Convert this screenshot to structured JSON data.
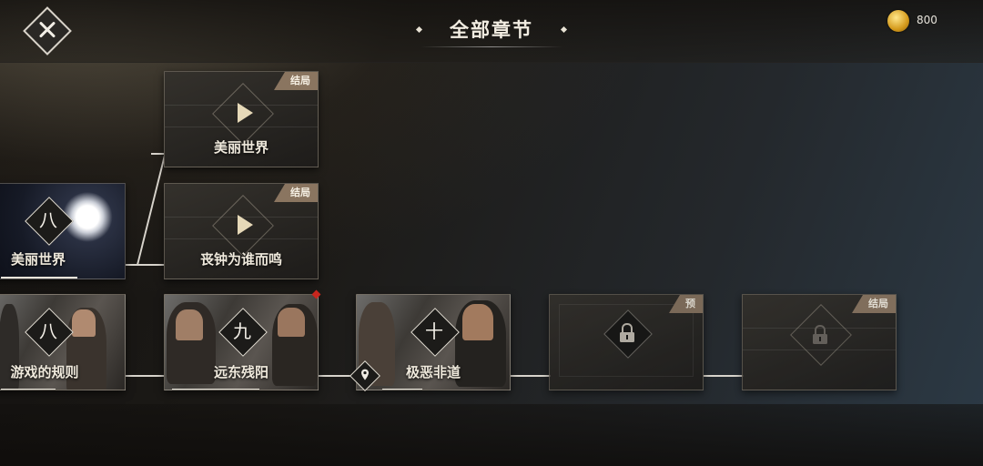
{
  "header": {
    "title": "全部章节",
    "coins": "800",
    "close_icon": "close-x-icon",
    "coin_icon": "gold-coin-icon"
  },
  "chapters": {
    "branch": [
      {
        "label": "美丽世界",
        "tag": "结局",
        "icon": "play-icon"
      },
      {
        "label": "丧钟为谁而鸣",
        "tag": "结局",
        "icon": "play-icon"
      }
    ],
    "ch8_alt": {
      "numeral": "八",
      "label": "美丽世界"
    },
    "ch8": {
      "numeral": "八",
      "label": "游戏的规则"
    },
    "ch9": {
      "numeral": "九",
      "label": "远东残阳"
    },
    "ch10": {
      "numeral": "十",
      "label": "极恶非道"
    },
    "locked1": {
      "tag": "预",
      "icon": "lock-icon"
    },
    "locked2": {
      "tag": "结局",
      "icon": "lock-icon"
    }
  },
  "colors": {
    "tag_bg": "#8a7560",
    "connector": "#d8d4cc",
    "new_marker": "#c8261e"
  }
}
